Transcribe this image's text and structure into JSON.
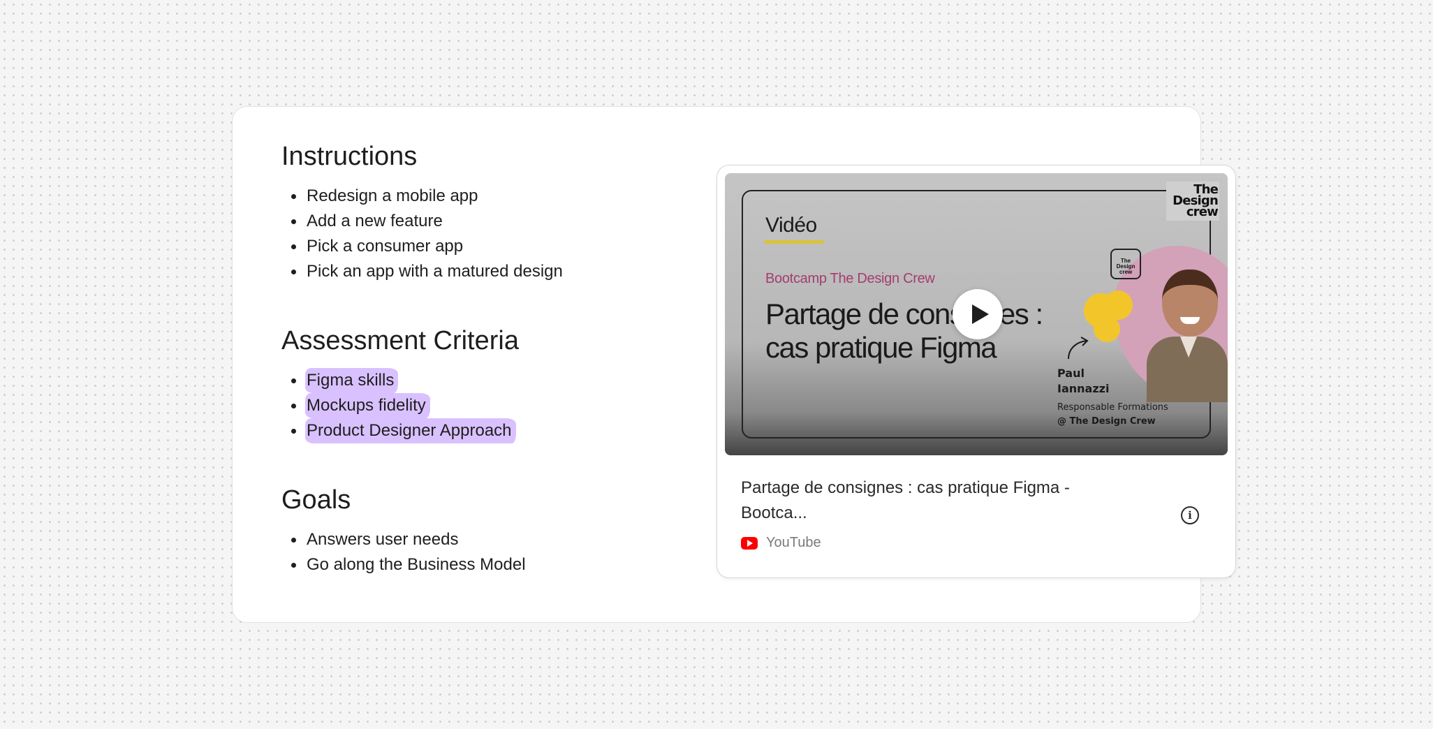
{
  "instructions": {
    "heading": "Instructions",
    "items": [
      "Redesign a mobile app",
      "Add a new feature",
      "Pick a consumer app",
      "Pick an app with a matured design"
    ]
  },
  "assessment": {
    "heading": "Assessment Criteria",
    "items": [
      "Figma skills",
      "Mockups fidelity",
      "Product Designer Approach"
    ],
    "highlight_color": "#d9c1ff"
  },
  "goals": {
    "heading": "Goals",
    "items": [
      "Answers user needs",
      "Go along the Business Model"
    ]
  },
  "video_embed": {
    "thumbnail": {
      "label": "Vidéo",
      "brand": "The Design crew",
      "mini_brand": "The Design crew",
      "subtitle": "Bootcamp The Design Crew",
      "title": "Partage de consignes : cas pratique Figma",
      "presenter_name": "Paul Iannazzi",
      "presenter_role": "Responsable Formations",
      "presenter_org": "@ The Design Crew"
    },
    "title": "Partage de consignes : cas pratique Figma - Bootca...",
    "source": "YouTube",
    "source_icon": "youtube-icon",
    "info_icon": "info-icon"
  }
}
